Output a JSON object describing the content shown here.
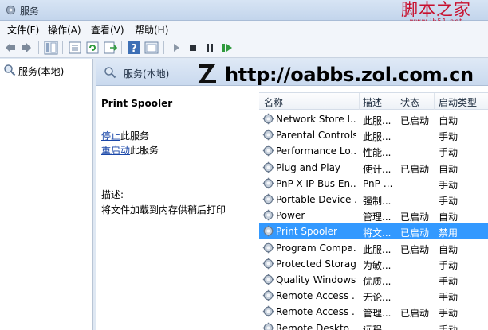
{
  "window": {
    "title": "服务"
  },
  "watermark": {
    "site_cn": "脚本之家",
    "site_url_small": "www.jb51.net",
    "url": "http://oabbs.zol.com.cn"
  },
  "menu": [
    "文件(F)",
    "操作(A)",
    "查看(V)",
    "帮助(H)"
  ],
  "toolbar": {
    "buttons": [
      "back-icon",
      "forward-icon",
      "show-tree-icon",
      "properties-icon",
      "refresh-icon",
      "export-icon",
      "help-icon",
      "console-icon",
      "play-icon",
      "stop-icon",
      "pause-icon",
      "restart-icon"
    ]
  },
  "tree": {
    "root_label": "服务(本地)"
  },
  "pane_header": {
    "label": "服务(本地)"
  },
  "detail": {
    "service_name": "Print Spooler",
    "stop_link": "停止",
    "stop_suffix": "此服务",
    "restart_link": "重启动",
    "restart_suffix": "此服务",
    "desc_label": "描述:",
    "desc_text": "将文件加载到内存供稍后打印"
  },
  "columns": {
    "name": "名称",
    "desc": "描述",
    "status": "状态",
    "startup": "启动类型"
  },
  "rows": [
    {
      "name": "Network Store I...",
      "desc": "此服...",
      "status": "已启动",
      "startup": "自动",
      "selected": false
    },
    {
      "name": "Parental Controls",
      "desc": "此服...",
      "status": "",
      "startup": "手动",
      "selected": false
    },
    {
      "name": "Performance Lo...",
      "desc": "性能...",
      "status": "",
      "startup": "手动",
      "selected": false
    },
    {
      "name": "Plug and Play",
      "desc": "使计...",
      "status": "已启动",
      "startup": "自动",
      "selected": false
    },
    {
      "name": "PnP-X IP Bus En...",
      "desc": "PnP-...",
      "status": "",
      "startup": "手动",
      "selected": false
    },
    {
      "name": "Portable Device ...",
      "desc": "强制...",
      "status": "",
      "startup": "手动",
      "selected": false
    },
    {
      "name": "Power",
      "desc": "管理...",
      "status": "已启动",
      "startup": "自动",
      "selected": false
    },
    {
      "name": "Print Spooler",
      "desc": "将文...",
      "status": "已启动",
      "startup": "禁用",
      "selected": true
    },
    {
      "name": "Program Compa...",
      "desc": "此服...",
      "status": "已启动",
      "startup": "自动",
      "selected": false
    },
    {
      "name": "Protected Storage",
      "desc": "为敏...",
      "status": "",
      "startup": "手动",
      "selected": false
    },
    {
      "name": "Quality Windows...",
      "desc": "优质...",
      "status": "",
      "startup": "手动",
      "selected": false
    },
    {
      "name": "Remote Access ...",
      "desc": "无论...",
      "status": "",
      "startup": "手动",
      "selected": false
    },
    {
      "name": "Remote Access ...",
      "desc": "管理...",
      "status": "已启动",
      "startup": "手动",
      "selected": false
    },
    {
      "name": "Remote Deskto...",
      "desc": "远程...",
      "status": "",
      "startup": "手动",
      "selected": false
    }
  ],
  "colors": {
    "selection": "#3399ff",
    "link": "#1a47a8",
    "watermark_red": "#c8102e"
  }
}
